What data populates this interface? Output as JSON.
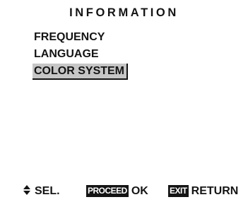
{
  "menu": {
    "title": "INFORMATION",
    "items": [
      {
        "label": "FREQUENCY"
      },
      {
        "label": "LANGUAGE"
      },
      {
        "label": "COLOR SYSTEM"
      }
    ],
    "selected_index": 2
  },
  "footer": {
    "select": {
      "icon": "up-down-arrows-icon",
      "label": "SEL."
    },
    "proceed": {
      "key": "PROCEED",
      "label": "OK"
    },
    "exit": {
      "key": "EXIT",
      "label": "RETURN"
    }
  },
  "colors": {
    "text": "#141414",
    "background": "#ffffff",
    "highlight": "#c6c6c6"
  }
}
